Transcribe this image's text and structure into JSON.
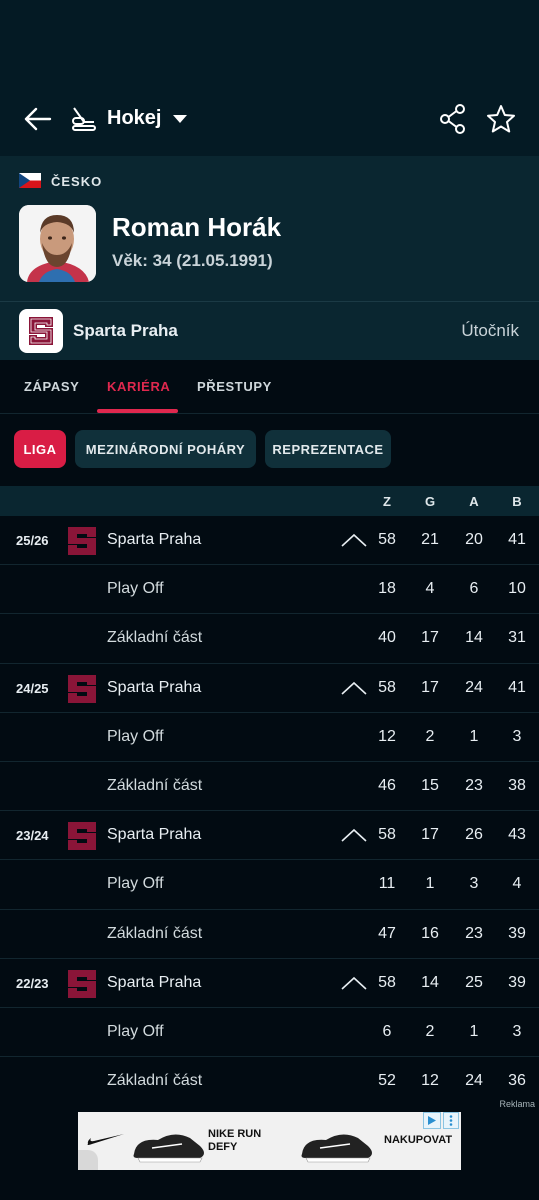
{
  "header": {
    "sport_title": "Hokej",
    "icons": [
      "back-arrow-icon",
      "hockey-stick-icon",
      "caret-down-icon",
      "share-icon",
      "star-icon"
    ]
  },
  "player": {
    "country": "ČESKO",
    "name": "Roman Horák",
    "age_line": "Věk: 34 (21.05.1991)"
  },
  "team": {
    "name": "Sparta Praha",
    "position": "Útočník",
    "logo_letter": "S"
  },
  "tabs": [
    {
      "label": "ZÁPASY",
      "active": false
    },
    {
      "label": "KARIÉRA",
      "active": true
    },
    {
      "label": "PŘESTUPY",
      "active": false
    }
  ],
  "filters": [
    {
      "label": "LIGA",
      "active": true
    },
    {
      "label": "MEZINÁRODNÍ POHÁRY",
      "active": false
    },
    {
      "label": "REPREZENTACE",
      "active": false
    }
  ],
  "table": {
    "columns": [
      "Z",
      "G",
      "A",
      "B"
    ],
    "seasons": [
      {
        "season": "25/26",
        "team": "Sparta Praha",
        "stats": [
          "58",
          "21",
          "20",
          "41"
        ],
        "breakdown": [
          {
            "label": "Play Off",
            "stats": [
              "18",
              "4",
              "6",
              "10"
            ]
          },
          {
            "label": "Základní část",
            "stats": [
              "40",
              "17",
              "14",
              "31"
            ]
          }
        ]
      },
      {
        "season": "24/25",
        "team": "Sparta Praha",
        "stats": [
          "58",
          "17",
          "24",
          "41"
        ],
        "breakdown": [
          {
            "label": "Play Off",
            "stats": [
              "12",
              "2",
              "1",
              "3"
            ]
          },
          {
            "label": "Základní část",
            "stats": [
              "46",
              "15",
              "23",
              "38"
            ]
          }
        ]
      },
      {
        "season": "23/24",
        "team": "Sparta Praha",
        "stats": [
          "58",
          "17",
          "26",
          "43"
        ],
        "breakdown": [
          {
            "label": "Play Off",
            "stats": [
              "11",
              "1",
              "3",
              "4"
            ]
          },
          {
            "label": "Základní část",
            "stats": [
              "47",
              "16",
              "23",
              "39"
            ]
          }
        ]
      },
      {
        "season": "22/23",
        "team": "Sparta Praha",
        "stats": [
          "58",
          "14",
          "25",
          "39"
        ],
        "breakdown": [
          {
            "label": "Play Off",
            "stats": [
              "6",
              "2",
              "1",
              "3"
            ]
          },
          {
            "label": "Základní část",
            "stats": [
              "52",
              "12",
              "24",
              "36"
            ]
          }
        ]
      }
    ]
  },
  "ad": {
    "label": "Reklama",
    "title_line1": "NIKE RUN",
    "title_line2": "DEFY",
    "cta": "NAKUPOVAT"
  },
  "colors": {
    "accent": "#e0284e",
    "header_bg": "#041a24",
    "panel_bg": "#0a2630",
    "page_bg": "#020b12"
  }
}
